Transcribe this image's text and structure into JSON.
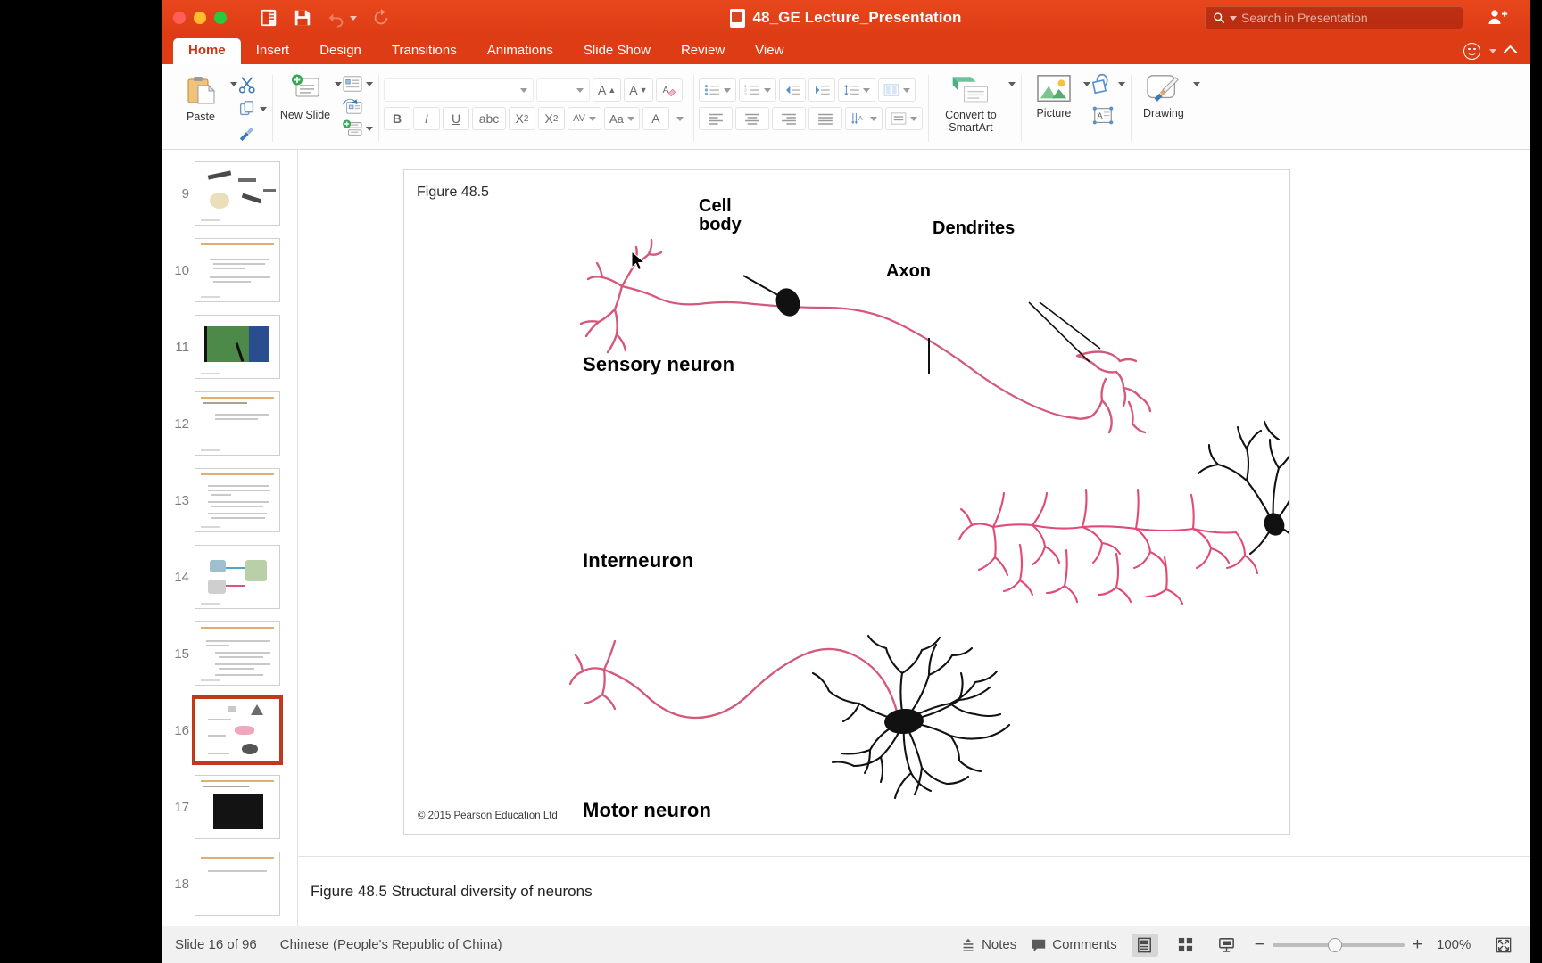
{
  "window": {
    "title": "48_GE Lecture_Presentation",
    "app_icon": "powerpoint-icon"
  },
  "titlebar": {
    "traffic_lights": [
      "close",
      "minimize",
      "zoom"
    ],
    "quick_access": [
      {
        "name": "template-chooser-icon",
        "label": "Template"
      },
      {
        "name": "save-icon",
        "label": "Save"
      },
      {
        "name": "undo-icon",
        "label": "Undo"
      },
      {
        "name": "redo-icon",
        "label": "Redo"
      }
    ],
    "share_icon": "add-person-icon"
  },
  "search": {
    "placeholder": "Search in Presentation",
    "icon": "search-icon",
    "caret": "chevron-down-icon"
  },
  "tabs": [
    {
      "label": "Home",
      "active": true
    },
    {
      "label": "Insert",
      "active": false
    },
    {
      "label": "Design",
      "active": false
    },
    {
      "label": "Transitions",
      "active": false
    },
    {
      "label": "Animations",
      "active": false
    },
    {
      "label": "Slide Show",
      "active": false
    },
    {
      "label": "Review",
      "active": false
    },
    {
      "label": "View",
      "active": false
    }
  ],
  "tabs_right": {
    "smiley_icon": "smiley-icon",
    "collapse_icon": "chevron-up-icon"
  },
  "ribbon": {
    "clipboard": {
      "paste_label": "Paste",
      "cut_icon": "scissors-icon",
      "copy_icon": "copy-icon",
      "format_painter_icon": "format-painter-icon"
    },
    "slides": {
      "new_slide_label": "New Slide",
      "layout_icon": "slide-layout-icon",
      "reset_icon": "reset-slide-icon",
      "section_icon": "section-icon"
    },
    "font": {
      "font_name": "",
      "font_size": "",
      "grow_font_label": "A",
      "shrink_font_label": "A",
      "clear_formatting_icon": "clear-formatting-icon",
      "bold_label": "B",
      "italic_label": "I",
      "underline_label": "U",
      "strikethrough_label": "abc",
      "superscript_label": "X",
      "subscript_label": "X",
      "character_spacing_label": "AV",
      "change_case_label": "Aa",
      "font_color_label": "A"
    },
    "paragraph": {
      "bullets_icon": "bullets-icon",
      "numbering_icon": "numbering-icon",
      "decrease_indent_icon": "decrease-indent-icon",
      "increase_indent_icon": "increase-indent-icon",
      "line_spacing_icon": "line-spacing-icon",
      "columns_icon": "columns-icon",
      "align_left_icon": "align-left-icon",
      "align_center_icon": "align-center-icon",
      "align_right_icon": "align-right-icon",
      "justify_icon": "justify-icon",
      "text_direction_icon": "text-direction-icon",
      "align_text_icon": "align-text-icon"
    },
    "smartart": {
      "label": "Convert to SmartArt",
      "icon": "smartart-icon"
    },
    "insert": {
      "picture_label": "Picture",
      "picture_icon": "picture-icon",
      "shapes_icon": "shapes-icon",
      "textbox_icon": "text-box-icon"
    },
    "drawing": {
      "label": "Drawing",
      "icon": "paintbrush-icon"
    }
  },
  "thumbnails": [
    {
      "number": "9",
      "selected": false,
      "kind": "image"
    },
    {
      "number": "10",
      "selected": false,
      "kind": "text"
    },
    {
      "number": "11",
      "selected": false,
      "kind": "photo"
    },
    {
      "number": "12",
      "selected": false,
      "kind": "text"
    },
    {
      "number": "13",
      "selected": false,
      "kind": "text"
    },
    {
      "number": "14",
      "selected": false,
      "kind": "image"
    },
    {
      "number": "15",
      "selected": false,
      "kind": "text"
    },
    {
      "number": "16",
      "selected": true,
      "kind": "neuron"
    },
    {
      "number": "17",
      "selected": false,
      "kind": "photo"
    },
    {
      "number": "18",
      "selected": false,
      "kind": "text"
    }
  ],
  "slide": {
    "figure_label": "Figure 48.5",
    "copyright": "© 2015 Pearson Education Ltd",
    "callouts": [
      {
        "name": "cell-body-callout",
        "text": "Cell\nbody"
      },
      {
        "name": "dendrites-callout",
        "text": "Dendrites"
      },
      {
        "name": "axon-callout",
        "text": "Axon"
      }
    ],
    "callout_cell_body_line1": "Cell",
    "callout_cell_body_line2": "body",
    "callout_dendrites": "Dendrites",
    "callout_axon": "Axon",
    "neuron_labels": [
      {
        "name": "sensory-neuron-label",
        "text": "Sensory neuron"
      },
      {
        "name": "interneuron-label",
        "text": "Interneuron"
      },
      {
        "name": "motor-neuron-label",
        "text": "Motor neuron"
      }
    ],
    "label_sensory": "Sensory neuron",
    "label_interneuron": "Interneuron",
    "label_motor": "Motor neuron",
    "colors": {
      "neuron_red": "#d4587a",
      "neuron_black": "#111111"
    }
  },
  "notes": {
    "text": "Figure 48.5 Structural diversity of neurons"
  },
  "status": {
    "slide_counter": "Slide 16 of 96",
    "language": "Chinese (People's Republic of China)",
    "notes_label": "Notes",
    "notes_icon": "notes-icon",
    "comments_label": "Comments",
    "comments_icon": "comment-bubble-icon",
    "views": [
      {
        "name": "normal-view-button",
        "icon": "normal-view-icon",
        "active": true
      },
      {
        "name": "slide-sorter-button",
        "icon": "slide-sorter-icon",
        "active": false
      },
      {
        "name": "slide-show-button",
        "icon": "presenter-icon",
        "active": false
      }
    ],
    "zoom_out_label": "−",
    "zoom_in_label": "+",
    "zoom_level": "100%",
    "fit_icon": "fit-to-window-icon"
  }
}
